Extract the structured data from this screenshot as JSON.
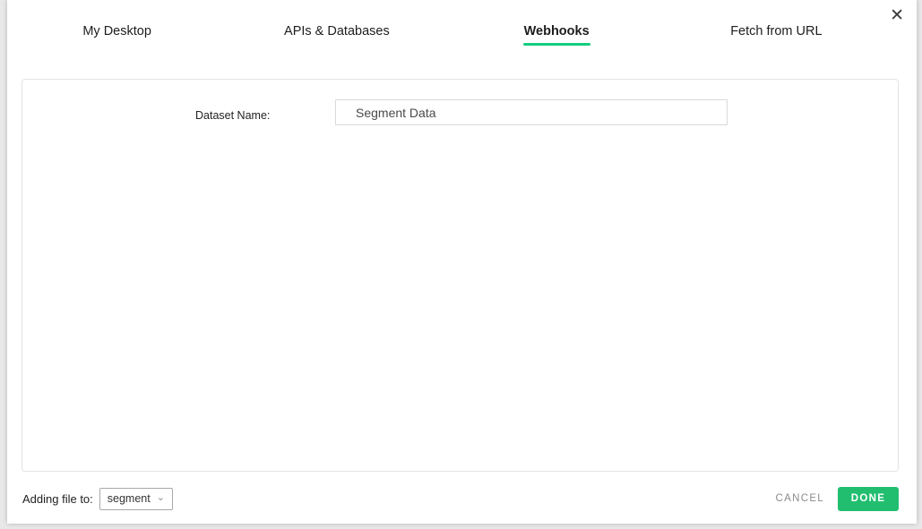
{
  "dialog": {
    "tabs": [
      {
        "label": "My Desktop",
        "active": false
      },
      {
        "label": "APIs & Databases",
        "active": false
      },
      {
        "label": "Webhooks",
        "active": true
      },
      {
        "label": "Fetch from URL",
        "active": false
      }
    ],
    "form": {
      "dataset_name_label": "Dataset Name:",
      "dataset_name_value": "Segment Data"
    },
    "footer": {
      "adding_file_label": "Adding file to:",
      "folder_selected": "segment",
      "cancel_label": "CANCEL",
      "done_label": "DONE"
    },
    "icons": {
      "close": "✕",
      "chevron_down": "⌄"
    },
    "colors": {
      "accent_green": "#22be70",
      "underline_green": "#15cd7e"
    }
  }
}
